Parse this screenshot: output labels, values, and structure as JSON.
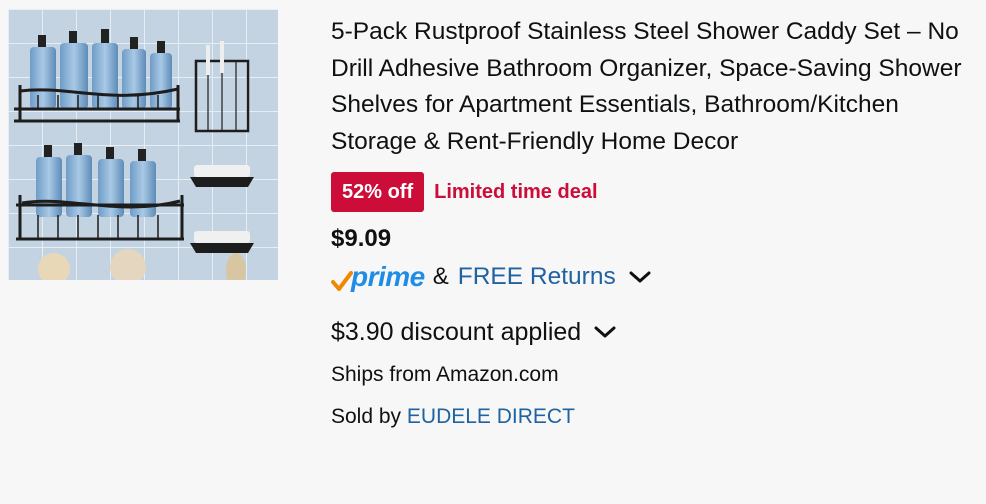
{
  "product": {
    "title": "5-Pack Rustproof Stainless Steel Shower Caddy Set – No Drill Adhesive Bathroom Organizer, Space-Saving Shower Shelves for Apartment Essentials, Bathroom/Kitchen Storage & Rent-Friendly Home Decor",
    "image_icon": "shower-caddy-product-image"
  },
  "deal": {
    "badge": "52% off",
    "label": "Limited time deal",
    "color": "#cc0c39"
  },
  "price": "$9.09",
  "delivery": {
    "prime_label": "prime",
    "amp": "&",
    "returns_label": "FREE Returns"
  },
  "discount": {
    "text": "$3.90 discount applied"
  },
  "shipping": {
    "ships_from": "Ships from Amazon.com",
    "sold_by_prefix": "Sold by ",
    "seller": "EUDELE DIRECT"
  },
  "colors": {
    "link": "#2162a1",
    "prime_blue": "#1f8ce6",
    "prime_check": "#f08804"
  }
}
